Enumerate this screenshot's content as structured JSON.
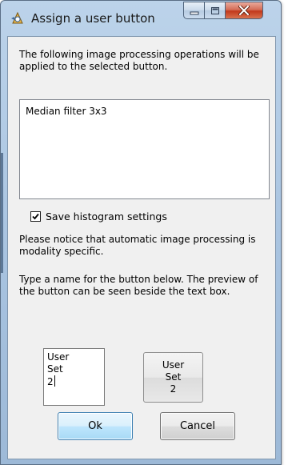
{
  "window": {
    "title": "Assign a user button",
    "icons": {
      "app": "app-icon",
      "minimize": "minimize-icon",
      "maximize": "maximize-icon",
      "close": "close-icon"
    },
    "colors": {
      "close_button": "#c2391c",
      "frame": "#a8c3e0",
      "ok_border": "#3c7fb1"
    }
  },
  "dialog": {
    "intro": "The following image processing operations will be applied to the selected button.",
    "operations": [
      "Median filter 3x3"
    ],
    "save_histogram": {
      "label": "Save histogram settings",
      "checked": true,
      "check_mark": "✔"
    },
    "notice": "Please notice that automatic image processing is modality specific.",
    "name_instruction": "Type a name for the button below. The preview of the button can be seen beside the text box.",
    "name_lines": [
      "User",
      "Set",
      "2"
    ],
    "preview_lines": [
      "User",
      "Set",
      "2"
    ],
    "ok_label": "Ok",
    "cancel_label": "Cancel"
  }
}
